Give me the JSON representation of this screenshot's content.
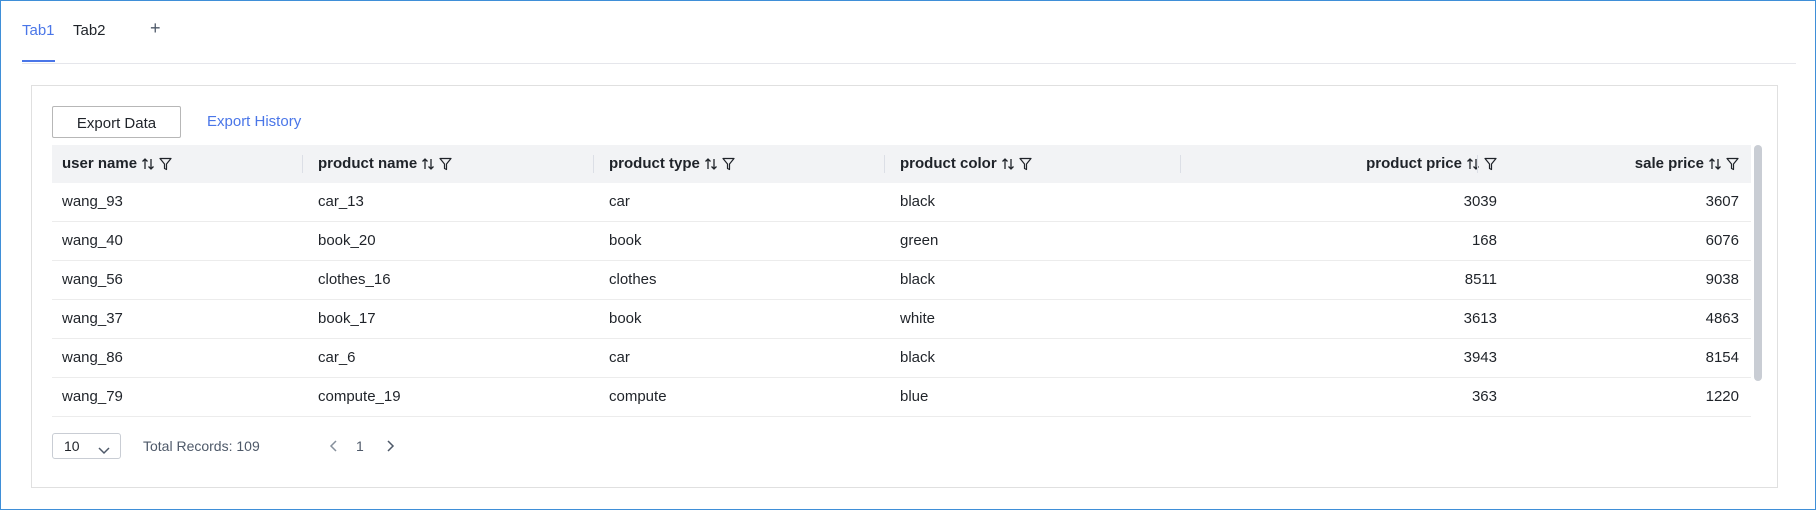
{
  "tabs": [
    {
      "label": "Tab1",
      "active": true
    },
    {
      "label": "Tab2",
      "active": false
    }
  ],
  "tab_add_label": "+",
  "toolbar": {
    "export_label": "Export Data",
    "history_label": "Export History"
  },
  "table": {
    "columns": [
      {
        "key": "user_name",
        "label": "user name"
      },
      {
        "key": "product_name",
        "label": "product name"
      },
      {
        "key": "product_type",
        "label": "product type"
      },
      {
        "key": "product_color",
        "label": "product color"
      },
      {
        "key": "product_price",
        "label": "product price"
      },
      {
        "key": "sale_price",
        "label": "sale price"
      }
    ],
    "rows": [
      [
        "wang_93",
        "car_13",
        "car",
        "black",
        "3039",
        "3607"
      ],
      [
        "wang_40",
        "book_20",
        "book",
        "green",
        "168",
        "6076"
      ],
      [
        "wang_56",
        "clothes_16",
        "clothes",
        "black",
        "8511",
        "9038"
      ],
      [
        "wang_37",
        "book_17",
        "book",
        "white",
        "3613",
        "4863"
      ],
      [
        "wang_86",
        "car_6",
        "car",
        "black",
        "3943",
        "8154"
      ],
      [
        "wang_79",
        "compute_19",
        "compute",
        "blue",
        "363",
        "1220"
      ]
    ]
  },
  "pagination": {
    "page_size": "10",
    "total_label": "Total Records: 109",
    "current_page": "1"
  },
  "colors": {
    "accent": "#4a76e8",
    "frame_border": "#3f8fd8",
    "header_bg": "#f2f3f5"
  }
}
